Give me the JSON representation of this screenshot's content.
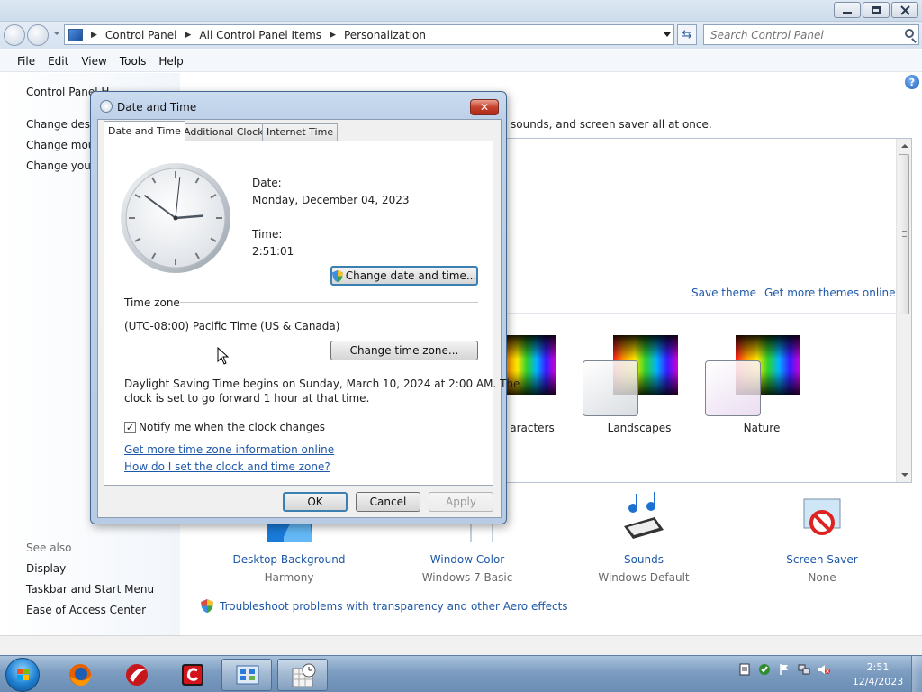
{
  "address": {
    "crumbs": [
      "Control Panel",
      "All Control Panel Items",
      "Personalization"
    ],
    "search_placeholder": "Search Control Panel"
  },
  "menu": [
    "File",
    "Edit",
    "View",
    "Tools",
    "Help"
  ],
  "left_nav": {
    "home": "Control Panel H",
    "tasks": [
      "Change deskt",
      "Change mous",
      "Change your"
    ],
    "see_also_label": "See also",
    "see_also": [
      "Display",
      "Taskbar and Start Menu",
      "Ease of Access Center"
    ]
  },
  "content": {
    "subtitle_fragment": "sounds, and screen saver all at once.",
    "save_theme": "Save theme",
    "get_more_themes": "Get more themes online",
    "themes": [
      {
        "label": "aracters"
      },
      {
        "label": "Landscapes"
      },
      {
        "label": "Nature"
      }
    ],
    "settings": [
      {
        "name": "Desktop Background",
        "value": "Harmony",
        "icon": "desktop-background-icon"
      },
      {
        "name": "Window Color",
        "value": "Windows 7 Basic",
        "icon": "window-color-icon"
      },
      {
        "name": "Sounds",
        "value": "Windows Default",
        "icon": "sounds-icon"
      },
      {
        "name": "Screen Saver",
        "value": "None",
        "icon": "screen-saver-icon"
      }
    ],
    "troubleshoot": "Troubleshoot problems with transparency and other Aero effects"
  },
  "dialog": {
    "title": "Date and Time",
    "close_glyph": "✕",
    "tabs": [
      "Date and Time",
      "Additional Clocks",
      "Internet Time"
    ],
    "active_tab": "Date and Time",
    "date_label": "Date:",
    "date_value": "Monday, December 04, 2023",
    "time_label": "Time:",
    "time_value": "2:51:01",
    "change_date_time": "Change date and time...",
    "time_zone_label": "Time zone",
    "time_zone_value": "(UTC-08:00) Pacific Time (US & Canada)",
    "change_time_zone": "Change time zone...",
    "dst_line1": "Daylight Saving Time begins on Sunday, March 10, 2024 at 2:00 AM. The",
    "dst_line2": "clock is set to go forward 1 hour at that time.",
    "notify_label": "Notify me when the clock changes",
    "notify_checked": true,
    "check_glyph": "✓",
    "link_more_info": "Get more time zone information online",
    "link_how_set": "How do I set the clock and time zone?",
    "ok": "OK",
    "cancel": "Cancel",
    "apply": "Apply",
    "clock": {
      "hours": 2,
      "minutes": 51,
      "seconds": 1
    }
  },
  "taskbar": {
    "time": "2:51",
    "date": "12/4/2023",
    "items": [
      "firefox-icon",
      "app-icon",
      "app-icon-2",
      "control-panel-icon",
      "date-time-icon"
    ]
  },
  "colors": {
    "link": "#1e58a8",
    "taskbar": "#7c9cc0"
  }
}
